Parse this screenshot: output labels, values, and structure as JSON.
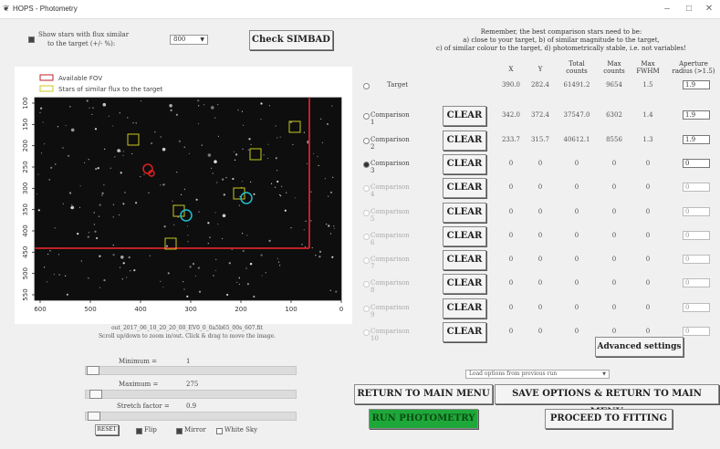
{
  "window": {
    "title": "HOPS - Photometry",
    "icon": "feather-icon"
  },
  "top_left": {
    "show_stars_label_line1": "Show stars with flux similar",
    "show_stars_label_line2": "to the target (+/- %):",
    "flux_percent_value": "800",
    "check_simbad_label": "Check SIMBAD"
  },
  "reminder": {
    "line1": "Remember, the best comparison stars need to be:",
    "line2": "a) close to your target, b) of similar magnitude to the target,",
    "line3": "c) of similar colour to the target, d) photometrically stable, i.e. not variables!"
  },
  "image_panel": {
    "legend_fov": "Available FOV",
    "legend_similar": "Stars of similar flux to the target",
    "filename": "out_2017_06_10_20_20_00_EV0_0_0a5b65_00s_607.fit",
    "hint": "Scroll up/down to zoom in/out. Click & drag to move the image.",
    "x_ticks": [
      "600",
      "500",
      "400",
      "300",
      "200",
      "100",
      "0"
    ],
    "y_ticks": [
      "100",
      "150",
      "200",
      "250",
      "300",
      "350",
      "400",
      "450",
      "500",
      "550"
    ]
  },
  "table": {
    "headers": {
      "x": "X",
      "y": "Y",
      "total_l1": "Total",
      "total_l2": "counts",
      "max_l1": "Max",
      "max_l2": "counts",
      "fwhm_l1": "Max",
      "fwhm_l2": "FWHM",
      "ap_l1": "Aperture",
      "ap_l2": "radius (>1.5)"
    },
    "clear_label": "CLEAR",
    "rows": [
      {
        "label": "Target",
        "x": "390.0",
        "y": "282.4",
        "total": "61491.2",
        "max": "9654",
        "fwhm": "1.5",
        "aperture": "1.9",
        "has_clear": false,
        "selected": false,
        "active": true
      },
      {
        "label": "Comparison 1",
        "x": "342.0",
        "y": "372.4",
        "total": "37547.0",
        "max": "6302",
        "fwhm": "1.4",
        "aperture": "1.9",
        "has_clear": true,
        "selected": false,
        "active": true
      },
      {
        "label": "Comparison 2",
        "x": "233.7",
        "y": "315.7",
        "total": "40612.1",
        "max": "8556",
        "fwhm": "1.3",
        "aperture": "1.9",
        "has_clear": true,
        "selected": false,
        "active": true
      },
      {
        "label": "Comparison 3",
        "x": "0",
        "y": "0",
        "total": "0",
        "max": "0",
        "fwhm": "0",
        "aperture": "0",
        "has_clear": true,
        "selected": true,
        "active": true
      },
      {
        "label": "Comparison 4",
        "x": "0",
        "y": "0",
        "total": "0",
        "max": "0",
        "fwhm": "0",
        "aperture": "0",
        "has_clear": true,
        "selected": false,
        "active": false
      },
      {
        "label": "Comparison 5",
        "x": "0",
        "y": "0",
        "total": "0",
        "max": "0",
        "fwhm": "0",
        "aperture": "0",
        "has_clear": true,
        "selected": false,
        "active": false
      },
      {
        "label": "Comparison 6",
        "x": "0",
        "y": "0",
        "total": "0",
        "max": "0",
        "fwhm": "0",
        "aperture": "0",
        "has_clear": true,
        "selected": false,
        "active": false
      },
      {
        "label": "Comparison 7",
        "x": "0",
        "y": "0",
        "total": "0",
        "max": "0",
        "fwhm": "0",
        "aperture": "0",
        "has_clear": true,
        "selected": false,
        "active": false
      },
      {
        "label": "Comparison 8",
        "x": "0",
        "y": "0",
        "total": "0",
        "max": "0",
        "fwhm": "0",
        "aperture": "0",
        "has_clear": true,
        "selected": false,
        "active": false
      },
      {
        "label": "Comparison 9",
        "x": "0",
        "y": "0",
        "total": "0",
        "max": "0",
        "fwhm": "0",
        "aperture": "0",
        "has_clear": true,
        "selected": false,
        "active": false
      },
      {
        "label": "Comparison 10",
        "x": "0",
        "y": "0",
        "total": "0",
        "max": "0",
        "fwhm": "0",
        "aperture": "0",
        "has_clear": true,
        "selected": false,
        "active": false
      }
    ]
  },
  "advanced_settings_label": "Advanced settings",
  "load_options_placeholder": "Load options from previous run",
  "sliders": {
    "minimum_label": "Minimum =",
    "minimum_value": "1",
    "maximum_label": "Maximum =",
    "maximum_value": "275",
    "stretch_label": "Stretch factor =",
    "stretch_value": "0.9"
  },
  "bottom_controls": {
    "reset_label": "RESET",
    "flip_label": "Flip",
    "flip_checked": true,
    "mirror_label": "Mirror",
    "mirror_checked": true,
    "white_sky_label": "White Sky",
    "white_sky_checked": false
  },
  "actions": {
    "return_main": "RETURN TO MAIN MENU",
    "save_return": "SAVE OPTIONS & RETURN TO MAIN MENU",
    "run_photometry": "RUN PHOTOMETRY",
    "proceed_fitting": "PROCEED TO FITTING"
  },
  "colors": {
    "run_green": "#1fa83a",
    "fov_red": "#c0202a",
    "similar_yellow": "#c8c820",
    "selected_cyan": "#20c0d0"
  }
}
